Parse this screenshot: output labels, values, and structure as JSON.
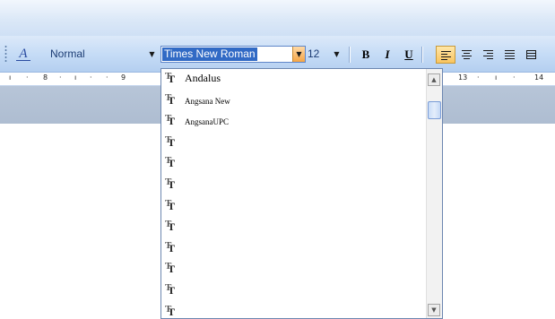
{
  "toolbar": {
    "style_icon": "A",
    "style_value": "Normal",
    "font_value": "Times New Roman",
    "size_value": "12",
    "bold_label": "B",
    "italic_label": "I",
    "underline_label": "U",
    "icons": [
      "styles-formatting-icon",
      "align-left-icon",
      "align-center-icon",
      "align-right-icon",
      "justify-icon",
      "distributed-icon"
    ]
  },
  "ruler": {
    "left_marks": [
      "8",
      "9"
    ],
    "right_marks": [
      "13",
      "14"
    ]
  },
  "font_dropdown": {
    "items": [
      {
        "name": "Andalus"
      },
      {
        "name": "Angsana New"
      },
      {
        "name": "AngsanaUPC"
      },
      {
        "name": ""
      },
      {
        "name": ""
      },
      {
        "name": ""
      },
      {
        "name": ""
      },
      {
        "name": ""
      },
      {
        "name": ""
      },
      {
        "name": ""
      },
      {
        "name": ""
      },
      {
        "name": ""
      }
    ],
    "item_icon": "truetype-font-icon",
    "scroll_fraction": 0.0
  },
  "colors": {
    "selection": "#316ac5",
    "active_button": "#f9c45f",
    "toolbar": "#c6dcf6"
  }
}
